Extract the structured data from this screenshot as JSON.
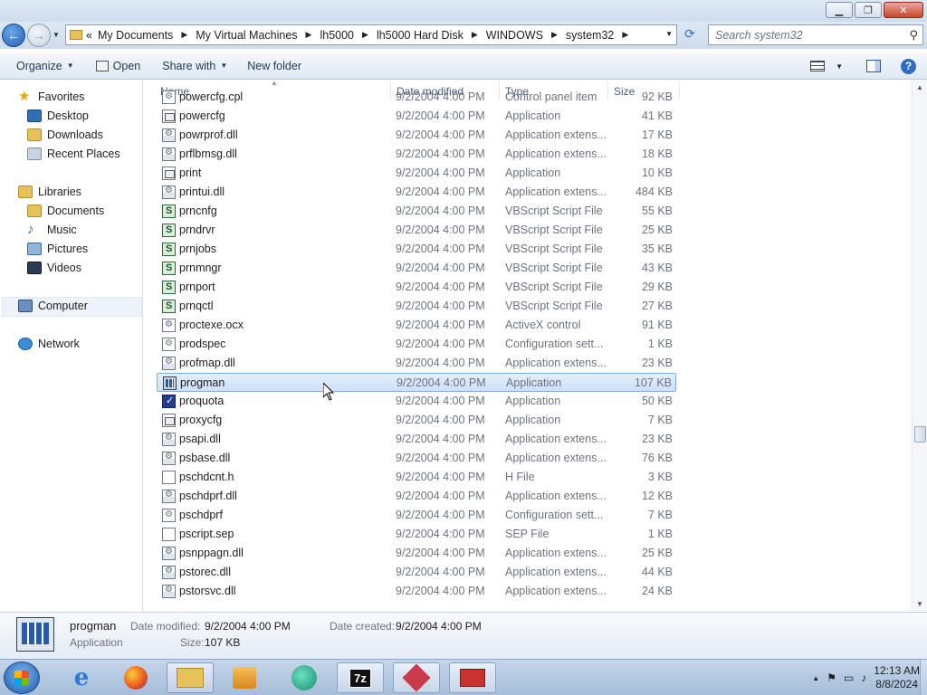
{
  "window": {
    "controls": {
      "minimize": "▁",
      "maximize": "❐",
      "close": "✕"
    }
  },
  "address": {
    "overflow": "«",
    "crumbs": [
      "My Documents",
      "My Virtual Machines",
      "lh5000",
      "lh5000 Hard Disk",
      "WINDOWS",
      "system32"
    ],
    "search_placeholder": "Search system32"
  },
  "toolbar": {
    "organize": "Organize",
    "open": "Open",
    "share_with": "Share with",
    "new_folder": "New folder"
  },
  "nav": {
    "favorites": "Favorites",
    "desktop": "Desktop",
    "downloads": "Downloads",
    "recent_places": "Recent Places",
    "libraries": "Libraries",
    "documents": "Documents",
    "music": "Music",
    "pictures": "Pictures",
    "videos": "Videos",
    "computer": "Computer",
    "network": "Network"
  },
  "columns": {
    "name": "Name",
    "date": "Date modified",
    "type": "Type",
    "size": "Size"
  },
  "files": [
    {
      "name": "powercfg.cpl",
      "date": "9/2/2004 4:00 PM",
      "type": "Control panel item",
      "size": "92 KB",
      "icon": "cpl"
    },
    {
      "name": "powercfg",
      "date": "9/2/2004 4:00 PM",
      "type": "Application",
      "size": "41 KB",
      "icon": "app"
    },
    {
      "name": "powrprof.dll",
      "date": "9/2/2004 4:00 PM",
      "type": "Application extens...",
      "size": "17 KB",
      "icon": "dll"
    },
    {
      "name": "prflbmsg.dll",
      "date": "9/2/2004 4:00 PM",
      "type": "Application extens...",
      "size": "18 KB",
      "icon": "dll"
    },
    {
      "name": "print",
      "date": "9/2/2004 4:00 PM",
      "type": "Application",
      "size": "10 KB",
      "icon": "app"
    },
    {
      "name": "printui.dll",
      "date": "9/2/2004 4:00 PM",
      "type": "Application extens...",
      "size": "484 KB",
      "icon": "dll"
    },
    {
      "name": "prncnfg",
      "date": "9/2/2004 4:00 PM",
      "type": "VBScript Script File",
      "size": "55 KB",
      "icon": "vbs"
    },
    {
      "name": "prndrvr",
      "date": "9/2/2004 4:00 PM",
      "type": "VBScript Script File",
      "size": "25 KB",
      "icon": "vbs"
    },
    {
      "name": "prnjobs",
      "date": "9/2/2004 4:00 PM",
      "type": "VBScript Script File",
      "size": "35 KB",
      "icon": "vbs"
    },
    {
      "name": "prnmngr",
      "date": "9/2/2004 4:00 PM",
      "type": "VBScript Script File",
      "size": "43 KB",
      "icon": "vbs"
    },
    {
      "name": "prnport",
      "date": "9/2/2004 4:00 PM",
      "type": "VBScript Script File",
      "size": "29 KB",
      "icon": "vbs"
    },
    {
      "name": "prnqctl",
      "date": "9/2/2004 4:00 PM",
      "type": "VBScript Script File",
      "size": "27 KB",
      "icon": "vbs"
    },
    {
      "name": "proctexe.ocx",
      "date": "9/2/2004 4:00 PM",
      "type": "ActiveX control",
      "size": "91 KB",
      "icon": "ocx"
    },
    {
      "name": "prodspec",
      "date": "9/2/2004 4:00 PM",
      "type": "Configuration sett...",
      "size": "1 KB",
      "icon": "cfg"
    },
    {
      "name": "profmap.dll",
      "date": "9/2/2004 4:00 PM",
      "type": "Application extens...",
      "size": "23 KB",
      "icon": "dll"
    },
    {
      "name": "progman",
      "date": "9/2/2004 4:00 PM",
      "type": "Application",
      "size": "107 KB",
      "icon": "progman",
      "selected": true
    },
    {
      "name": "proquota",
      "date": "9/2/2004 4:00 PM",
      "type": "Application",
      "size": "50 KB",
      "icon": "proquota"
    },
    {
      "name": "proxycfg",
      "date": "9/2/2004 4:00 PM",
      "type": "Application",
      "size": "7 KB",
      "icon": "app"
    },
    {
      "name": "psapi.dll",
      "date": "9/2/2004 4:00 PM",
      "type": "Application extens...",
      "size": "23 KB",
      "icon": "dll"
    },
    {
      "name": "psbase.dll",
      "date": "9/2/2004 4:00 PM",
      "type": "Application extens...",
      "size": "76 KB",
      "icon": "dll"
    },
    {
      "name": "pschdcnt.h",
      "date": "9/2/2004 4:00 PM",
      "type": "H File",
      "size": "3 KB",
      "icon": "doc"
    },
    {
      "name": "pschdprf.dll",
      "date": "9/2/2004 4:00 PM",
      "type": "Application extens...",
      "size": "12 KB",
      "icon": "dll"
    },
    {
      "name": "pschdprf",
      "date": "9/2/2004 4:00 PM",
      "type": "Configuration sett...",
      "size": "7 KB",
      "icon": "cfg"
    },
    {
      "name": "pscript.sep",
      "date": "9/2/2004 4:00 PM",
      "type": "SEP File",
      "size": "1 KB",
      "icon": "doc"
    },
    {
      "name": "psnppagn.dll",
      "date": "9/2/2004 4:00 PM",
      "type": "Application extens...",
      "size": "25 KB",
      "icon": "dll"
    },
    {
      "name": "pstorec.dll",
      "date": "9/2/2004 4:00 PM",
      "type": "Application extens...",
      "size": "44 KB",
      "icon": "dll"
    },
    {
      "name": "pstorsvc.dll",
      "date": "9/2/2004 4:00 PM",
      "type": "Application extens...",
      "size": "24 KB",
      "icon": "dll"
    }
  ],
  "details": {
    "name": "progman",
    "type": "Application",
    "date_modified_label": "Date modified:",
    "date_modified": "9/2/2004 4:00 PM",
    "date_created_label": "Date created:",
    "date_created": "9/2/2004 4:00 PM",
    "size_label": "Size:",
    "size": "107 KB"
  },
  "taskbar": {
    "time": "12:13 AM",
    "date": "8/8/2024",
    "apps": [
      "internet-explorer-icon",
      "firefox-icon",
      "file-explorer-icon",
      "media-player-icon",
      "app-icon",
      "7zip-icon",
      "app-icon",
      "toolbox-icon"
    ],
    "zip_label": "7z"
  }
}
